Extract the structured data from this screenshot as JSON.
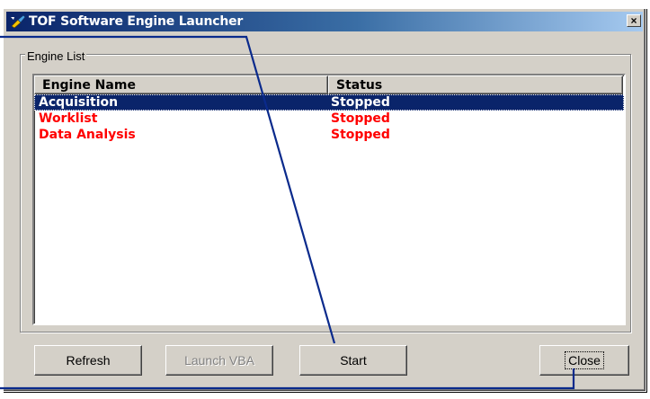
{
  "window": {
    "title": "TOF Software Engine Launcher",
    "close_glyph": "×",
    "icon": "launcher-app-icon"
  },
  "groupbox": {
    "label": "Engine List"
  },
  "listview": {
    "columns": [
      "Engine Name",
      "Status"
    ],
    "rows": [
      {
        "name": "Acquisition",
        "status": "Stopped",
        "selected": true,
        "color": "#ffffff"
      },
      {
        "name": "Worklist",
        "status": "Stopped",
        "selected": false,
        "color": "#ff0000"
      },
      {
        "name": "Data Analysis",
        "status": "Stopped",
        "selected": false,
        "color": "#ff0000"
      }
    ]
  },
  "buttons": {
    "refresh": "Refresh",
    "launch_vba": "Launch VBA",
    "start": "Start",
    "close": "Close"
  },
  "colors": {
    "titlebar_start": "#0a246a",
    "selection": "#0a246a",
    "stopped_text": "#ff0000",
    "callout_line": "#0a2a8c"
  }
}
